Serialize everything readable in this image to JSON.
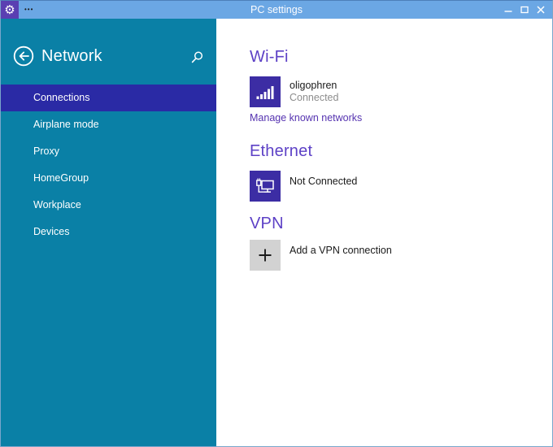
{
  "titlebar": {
    "menu_dots": "•••",
    "title": "PC settings"
  },
  "sidebar": {
    "title": "Network",
    "items": [
      {
        "label": "Connections",
        "selected": true
      },
      {
        "label": "Airplane mode",
        "selected": false
      },
      {
        "label": "Proxy",
        "selected": false
      },
      {
        "label": "HomeGroup",
        "selected": false
      },
      {
        "label": "Workplace",
        "selected": false
      },
      {
        "label": "Devices",
        "selected": false
      }
    ]
  },
  "content": {
    "wifi": {
      "title": "Wi-Fi",
      "network_name": "oligophren",
      "status": "Connected",
      "manage_link": "Manage known networks"
    },
    "ethernet": {
      "title": "Ethernet",
      "status": "Not Connected"
    },
    "vpn": {
      "title": "VPN",
      "action": "Add a VPN connection"
    }
  },
  "colors": {
    "titlebar_bg": "#6ba7e4",
    "app_icon_bg": "#5a3fb2",
    "sidebar_bg": "#0a80a6",
    "selected_item_bg": "#2a2aa5",
    "tile_bg": "#3c2da4",
    "section_header": "#5d41c6",
    "link": "#5533b0",
    "vpn_tile_bg": "#d2d2d2",
    "status_gray": "#8c8c8c"
  }
}
